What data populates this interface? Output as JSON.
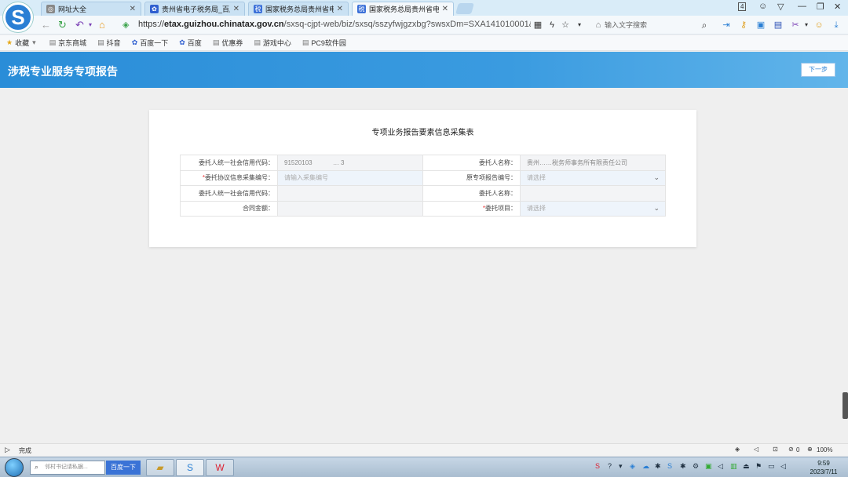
{
  "browser": {
    "tabs": [
      {
        "label": "网址大全",
        "active": false
      },
      {
        "label": "贵州省电子税务局_百度",
        "active": false
      },
      {
        "label": "国家税务总局贵州省电子",
        "active": false
      },
      {
        "label": "国家税务总局贵州省电子",
        "active": true
      }
    ],
    "tab_count": "4",
    "url_scheme": "https://",
    "url_domain": "etax.guizhou.chinatax.gov.cn",
    "url_path": "/sxsq-cjpt-web/biz/sxsq/sszyfwjgzxbg?swsxDm=SXA141010001&",
    "search_placeholder": "输入文字搜索"
  },
  "bookmarks": [
    {
      "label": "收藏",
      "icon": "star-icon"
    },
    {
      "label": "京东商城",
      "icon": "page-icon"
    },
    {
      "label": "抖音",
      "icon": "page-icon"
    },
    {
      "label": "百度一下",
      "icon": "paw-icon"
    },
    {
      "label": "百度",
      "icon": "paw-icon"
    },
    {
      "label": "优惠券",
      "icon": "page-icon"
    },
    {
      "label": "游戏中心",
      "icon": "page-icon"
    },
    {
      "label": "PC9软件园",
      "icon": "page-icon"
    }
  ],
  "page": {
    "title": "涉税专业服务专项报告",
    "next_button": "下一步",
    "form_title": "专项业务报告要素信息采集表",
    "rows": [
      {
        "l1": "委托人统一社会信用代码：",
        "v1": "91520103",
        "v1b": "…  3",
        "l2": "委托人名称：",
        "v2": "贵州……税务师事务所有限责任公司"
      },
      {
        "l1": "委托协议信息采集编号：",
        "v1": "请输入采集编号",
        "l2": "原专项报告编号：",
        "v2": "请选择"
      },
      {
        "l1": "委托人统一社会信用代码：",
        "v1": "",
        "l2": "委托人名称：",
        "v2": ""
      },
      {
        "l1": "合同金额：",
        "v1": "",
        "l2": "委托项目：",
        "v2": "请选择"
      }
    ],
    "required_mark": "*"
  },
  "status": {
    "text": "完成",
    "count": "0",
    "zoom": "100%"
  },
  "taskbar": {
    "search_placeholder": "邻村书记请私据...",
    "search_button": "百度一下",
    "time": "9:59",
    "date": "2023/7/11"
  },
  "colors": {
    "header_blue": "#2a8dd8",
    "accent": "#3a73d6",
    "required": "#e33333"
  }
}
